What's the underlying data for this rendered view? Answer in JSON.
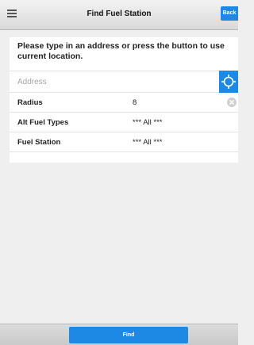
{
  "header": {
    "title": "Find Fuel Station",
    "back_label": "Back"
  },
  "form": {
    "instructions": "Please type in an address or press the button to use current location.",
    "address_placeholder": "Address",
    "rows": [
      {
        "label": "Radius",
        "value": "8"
      },
      {
        "label": "Alt Fuel Types",
        "value": "*** All ***"
      },
      {
        "label": "Fuel Station",
        "value": "*** All ***"
      }
    ]
  },
  "footer": {
    "find_label": "Find"
  },
  "colors": {
    "accent": "#1e88e5",
    "background": "#efefef",
    "panel": "#ffffff"
  },
  "icons": {
    "menu": "menu-icon",
    "location": "crosshair-icon",
    "clear": "clear-icon"
  }
}
